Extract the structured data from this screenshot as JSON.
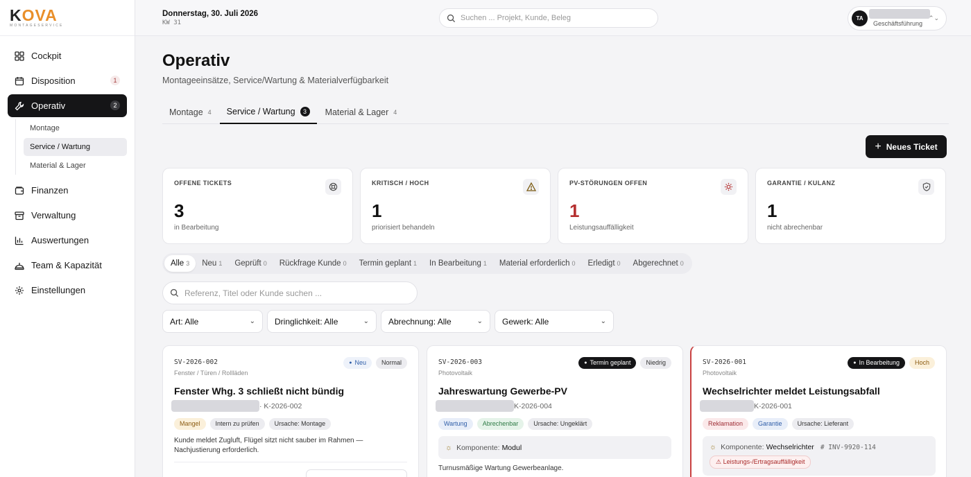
{
  "brand": {
    "logo_text_a": "K",
    "logo_text_b": "OVA",
    "logo_sub": "MONTAGESERVICE"
  },
  "sidebar": {
    "items": [
      {
        "label": "Cockpit",
        "icon": "grid-icon"
      },
      {
        "label": "Disposition",
        "icon": "calendar-icon",
        "badge": "1"
      },
      {
        "label": "Operativ",
        "icon": "wrench-icon",
        "badge": "2"
      },
      {
        "label": "Finanzen",
        "icon": "wallet-icon"
      },
      {
        "label": "Verwaltung",
        "icon": "archive-icon"
      },
      {
        "label": "Auswertungen",
        "icon": "bar-chart-icon"
      },
      {
        "label": "Team & Kapazität",
        "icon": "team-icon"
      },
      {
        "label": "Einstellungen",
        "icon": "gear-icon"
      }
    ],
    "sub_items": [
      "Montage",
      "Service / Wartung",
      "Material & Lager"
    ]
  },
  "topbar": {
    "date": "Donnerstag, 30. Juli 2026",
    "kw": "KW 31",
    "search_placeholder": "Suchen ... Projekt, Kunde, Beleg",
    "avatar": "TA",
    "role": "Geschäftsführung"
  },
  "page": {
    "title": "Operativ",
    "subtitle": "Montageeinsätze, Service/Wartung & Materialverfügbarkeit",
    "tabs": [
      {
        "label": "Montage",
        "count": "4"
      },
      {
        "label": "Service / Wartung",
        "count": "3"
      },
      {
        "label": "Material & Lager",
        "count": "4"
      }
    ],
    "new_ticket": "Neues Ticket"
  },
  "stats": [
    {
      "label": "OFFENE TICKETS",
      "value": "3",
      "sub": "in Bearbeitung",
      "icon": "lifebuoy-icon"
    },
    {
      "label": "KRITISCH / HOCH",
      "value": "1",
      "sub": "priorisiert behandeln",
      "icon": "warning-icon"
    },
    {
      "label": "PV-STÖRUNGEN OFFEN",
      "value": "1",
      "sub": "Leistungsauffälligkeit",
      "icon": "sun-icon"
    },
    {
      "label": "GARANTIE / KULANZ",
      "value": "1",
      "sub": "nicht abrechenbar",
      "icon": "shield-icon"
    }
  ],
  "status_filter": [
    {
      "label": "Alle",
      "count": "3"
    },
    {
      "label": "Neu",
      "count": "1"
    },
    {
      "label": "Geprüft",
      "count": "0"
    },
    {
      "label": "Rückfrage Kunde",
      "count": "0"
    },
    {
      "label": "Termin geplant",
      "count": "1"
    },
    {
      "label": "In Bearbeitung",
      "count": "1"
    },
    {
      "label": "Material erforderlich",
      "count": "0"
    },
    {
      "label": "Erledigt",
      "count": "0"
    },
    {
      "label": "Abgerechnet",
      "count": "0"
    }
  ],
  "ticket_search_placeholder": "Referenz, Titel oder Kunde suchen ...",
  "dropdowns": [
    "Art: Alle",
    "Dringlichkeit: Alle",
    "Abrechnung: Alle",
    "Gewerk: Alle"
  ],
  "tickets": [
    {
      "ref": "SV-2026-002",
      "category": "Fenster / Türen / Rollläden",
      "status": "Neu",
      "priority": "Normal",
      "title": "Fenster Whg. 3 schließt nicht bündig",
      "kunde": "· K-2026-002",
      "tags": [
        "Mangel",
        "Intern zu prüfen",
        "Ursache: Montage"
      ],
      "desc": "Kunde meldet Zugluft, Flügel sitzt nicht sauber im Rahmen — Nachjustierung erforderlich."
    },
    {
      "ref": "SV-2026-003",
      "category": "Photovoltaik",
      "status": "Termin geplant",
      "priority": "Niedrig",
      "title": "Jahreswartung Gewerbe-PV",
      "kunde": "K-2026-004",
      "tags": [
        "Wartung",
        "Abrechenbar",
        "Ursache: Ungeklärt"
      ],
      "comp_label": "Komponente:",
      "comp_value": "Modul",
      "note": "Turnusmäßige Wartung Gewerbeanlage."
    },
    {
      "ref": "SV-2026-001",
      "category": "Photovoltaik",
      "status": "In Bearbeitung",
      "priority": "Hoch",
      "title": "Wechselrichter meldet Leistungsabfall",
      "kunde": "K-2026-001",
      "tags": [
        "Reklamation",
        "Garantie",
        "Ursache: Lieferant"
      ],
      "comp_label": "Komponente:",
      "comp_value": "Wechselrichter",
      "inv": "# INV-9920-114",
      "warning": "Leistungs-/Ertragsauffälligkeit"
    }
  ],
  "colors": {
    "accent_dark": "#151517",
    "critical": "#b52f2f",
    "logo_orange": "#e98f2a"
  }
}
